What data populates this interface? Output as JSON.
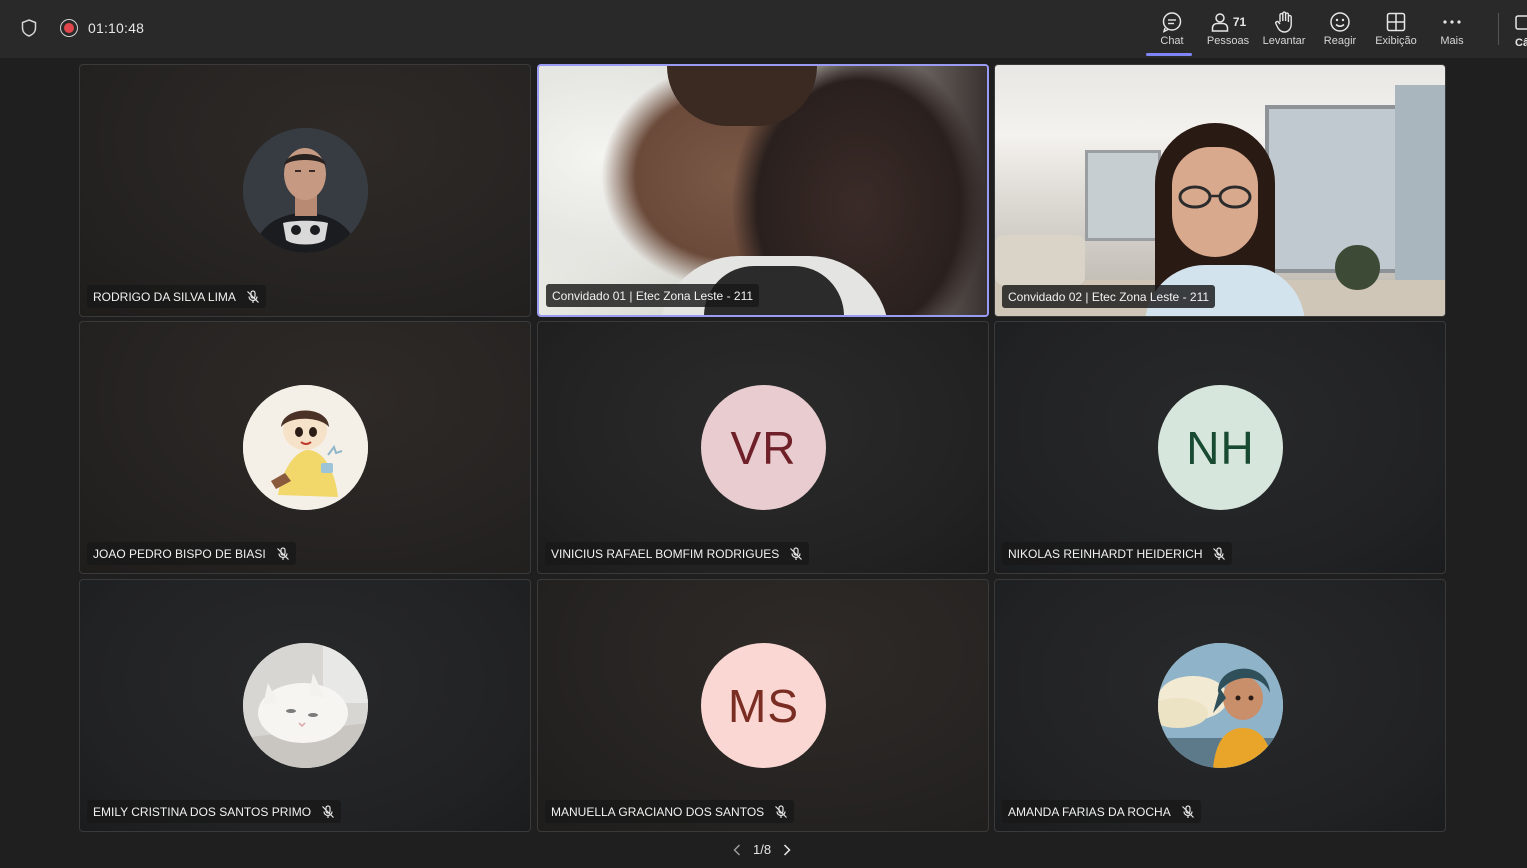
{
  "topbar": {
    "timer": "01:10:48",
    "people_count": "71",
    "buttons": [
      {
        "id": "chat",
        "label": "Chat",
        "icon": "chat-icon"
      },
      {
        "id": "people",
        "label": "Pessoas",
        "icon": "people-icon"
      },
      {
        "id": "raise",
        "label": "Levantar",
        "icon": "hand-icon"
      },
      {
        "id": "react",
        "label": "Reagir",
        "icon": "smile-icon"
      },
      {
        "id": "view",
        "label": "Exibição",
        "icon": "grid-icon"
      },
      {
        "id": "more",
        "label": "Mais",
        "icon": "more-icon"
      }
    ],
    "camera_label_partial": "Câ"
  },
  "participants": [
    {
      "name": "RODRIGO DA SILVA LIMA",
      "type": "photo",
      "muted": true
    },
    {
      "name": "Convidado 01 | Etec Zona Leste - 211",
      "type": "video",
      "muted": false
    },
    {
      "name": "Convidado 02 | Etec Zona Leste - 211",
      "type": "video",
      "muted": false
    },
    {
      "name": "JOAO PEDRO BISPO DE BIASI",
      "type": "photo",
      "muted": true
    },
    {
      "name": "VINICIUS RAFAEL BOMFIM RODRIGUES",
      "type": "initials",
      "initials": "VR",
      "avatar_bg": "#e8cccf",
      "initials_color": "#6e1f27",
      "muted": true
    },
    {
      "name": "NIKOLAS REINHARDT HEIDERICH",
      "type": "initials",
      "initials": "NH",
      "avatar_bg": "#d6e6dc",
      "initials_color": "#184a31",
      "muted": true
    },
    {
      "name": "EMILY CRISTINA DOS SANTOS PRIMO",
      "type": "photo",
      "muted": true
    },
    {
      "name": "MANUELLA GRACIANO DOS SANTOS",
      "type": "initials",
      "initials": "MS",
      "avatar_bg": "#fad7d2",
      "initials_color": "#7a2d22",
      "muted": true
    },
    {
      "name": "AMANDA FARIAS DA ROCHA",
      "type": "photo",
      "muted": true
    }
  ],
  "pager": {
    "label": "1/8"
  },
  "colors": {
    "accent": "#7f85f5",
    "active_border": "#9a9cf4",
    "background": "#1f1f1f",
    "topbar": "#292929"
  }
}
